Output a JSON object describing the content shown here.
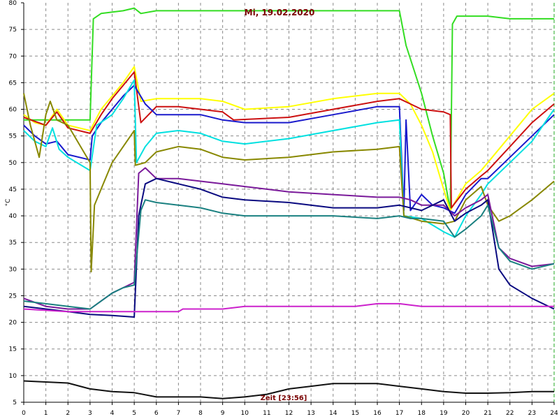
{
  "chart_data": {
    "type": "line",
    "title": "Mi, 19.02.2020",
    "xlabel": "Zeit [23:56]",
    "ylabel": "°C",
    "xlim": [
      0,
      24
    ],
    "ylim": [
      5,
      80
    ],
    "x_ticks": [
      0,
      1,
      2,
      3,
      4,
      5,
      6,
      7,
      8,
      9,
      10,
      11,
      12,
      13,
      14,
      15,
      16,
      17,
      18,
      19,
      20,
      21,
      22,
      23,
      24
    ],
    "y_ticks": [
      5,
      10,
      15,
      20,
      25,
      30,
      35,
      40,
      45,
      50,
      55,
      60,
      65,
      70,
      75,
      80
    ],
    "grid": true,
    "series": [
      {
        "color": "#33dd22",
        "points": [
          [
            0,
            58
          ],
          [
            1.5,
            58
          ],
          [
            3,
            58
          ],
          [
            3.15,
            77
          ],
          [
            3.5,
            78
          ],
          [
            4.5,
            78.5
          ],
          [
            5,
            79
          ],
          [
            5.3,
            78
          ],
          [
            6,
            78.5
          ],
          [
            10,
            78.5
          ],
          [
            14,
            78.5
          ],
          [
            17,
            78.5
          ],
          [
            17.3,
            72
          ],
          [
            18,
            63
          ],
          [
            18.5,
            55
          ],
          [
            19,
            48
          ],
          [
            19.3,
            41
          ],
          [
            19.4,
            76
          ],
          [
            19.6,
            77.5
          ],
          [
            21,
            77.5
          ],
          [
            22,
            77
          ],
          [
            24,
            77
          ]
        ]
      },
      {
        "color": "#ffff00",
        "points": [
          [
            0,
            59
          ],
          [
            0.5,
            57.5
          ],
          [
            1,
            57
          ],
          [
            1.5,
            60
          ],
          [
            2,
            57
          ],
          [
            3,
            56
          ],
          [
            3.5,
            60
          ],
          [
            4,
            62.5
          ],
          [
            4.5,
            65
          ],
          [
            5,
            68
          ],
          [
            5.3,
            61.5
          ],
          [
            6,
            62
          ],
          [
            7,
            62
          ],
          [
            8,
            62
          ],
          [
            9,
            61.5
          ],
          [
            10,
            60
          ],
          [
            12,
            60.5
          ],
          [
            14,
            62
          ],
          [
            16,
            63
          ],
          [
            17,
            63
          ],
          [
            17.5,
            61
          ],
          [
            18,
            57
          ],
          [
            18.5,
            52
          ],
          [
            19,
            45
          ],
          [
            19.3,
            41
          ],
          [
            20,
            46
          ],
          [
            20.7,
            48.5
          ],
          [
            21,
            50
          ],
          [
            22,
            55
          ],
          [
            23,
            60
          ],
          [
            24,
            63
          ]
        ]
      },
      {
        "color": "#cc1111",
        "points": [
          [
            0,
            58.5
          ],
          [
            1,
            57
          ],
          [
            1.5,
            59.5
          ],
          [
            2,
            56.5
          ],
          [
            3,
            55.5
          ],
          [
            3.5,
            59
          ],
          [
            4,
            62
          ],
          [
            4.5,
            64.5
          ],
          [
            5,
            67
          ],
          [
            5.3,
            57.5
          ],
          [
            6,
            60.5
          ],
          [
            7,
            60.5
          ],
          [
            8,
            60
          ],
          [
            9,
            59.5
          ],
          [
            9.5,
            58
          ],
          [
            12,
            58.5
          ],
          [
            14,
            60
          ],
          [
            16,
            61.5
          ],
          [
            17,
            62
          ],
          [
            17.5,
            61
          ],
          [
            18,
            60
          ],
          [
            19,
            59.5
          ],
          [
            19.3,
            59
          ],
          [
            19.35,
            41.5
          ],
          [
            20,
            45
          ],
          [
            20.7,
            47.5
          ],
          [
            21,
            48.5
          ],
          [
            22,
            53
          ],
          [
            23,
            57.5
          ],
          [
            24,
            61
          ]
        ]
      },
      {
        "color": "#1a1acc",
        "points": [
          [
            0,
            57
          ],
          [
            0.5,
            55
          ],
          [
            1,
            53.5
          ],
          [
            1.5,
            54
          ],
          [
            2,
            51.5
          ],
          [
            3,
            50.5
          ],
          [
            3.1,
            55
          ],
          [
            3.5,
            57.5
          ],
          [
            4,
            60
          ],
          [
            4.5,
            62.5
          ],
          [
            5,
            64.5
          ],
          [
            5.5,
            61
          ],
          [
            6,
            59
          ],
          [
            7,
            59
          ],
          [
            8,
            59
          ],
          [
            9,
            58
          ],
          [
            10,
            57.5
          ],
          [
            12,
            57.5
          ],
          [
            14,
            59
          ],
          [
            16,
            60.5
          ],
          [
            17,
            60.5
          ],
          [
            17.2,
            41
          ],
          [
            17.3,
            58
          ],
          [
            17.5,
            41
          ],
          [
            18,
            44
          ],
          [
            18.5,
            42
          ],
          [
            19,
            41.5
          ],
          [
            19.5,
            40.5
          ],
          [
            20,
            44
          ],
          [
            20.7,
            47
          ],
          [
            21,
            47
          ],
          [
            22,
            51
          ],
          [
            23,
            55
          ],
          [
            24,
            59
          ]
        ]
      },
      {
        "color": "#00e0e0",
        "points": [
          [
            0,
            56
          ],
          [
            0.5,
            54
          ],
          [
            1,
            53
          ],
          [
            1.3,
            56.5
          ],
          [
            1.6,
            52.5
          ],
          [
            2,
            51
          ],
          [
            3,
            48.5
          ],
          [
            3.3,
            57
          ],
          [
            4,
            59
          ],
          [
            4.5,
            62
          ],
          [
            5,
            65.5
          ],
          [
            5.1,
            50
          ],
          [
            5.5,
            53
          ],
          [
            6,
            55.5
          ],
          [
            7,
            56
          ],
          [
            8,
            55.5
          ],
          [
            9,
            54
          ],
          [
            10,
            53.5
          ],
          [
            12,
            54.5
          ],
          [
            14,
            56
          ],
          [
            16,
            57.5
          ],
          [
            17,
            58
          ],
          [
            17.2,
            40
          ],
          [
            18,
            39.5
          ],
          [
            19,
            37
          ],
          [
            19.5,
            36
          ],
          [
            20,
            40
          ],
          [
            20.7,
            44
          ],
          [
            21,
            46
          ],
          [
            22,
            50
          ],
          [
            23,
            54
          ],
          [
            24,
            60
          ]
        ]
      },
      {
        "color": "#888800",
        "points": [
          [
            0,
            63
          ],
          [
            0.3,
            57
          ],
          [
            0.7,
            51
          ],
          [
            1,
            59
          ],
          [
            1.2,
            61.5
          ],
          [
            1.5,
            58
          ],
          [
            2,
            57
          ],
          [
            3,
            50
          ],
          [
            3.05,
            29.5
          ],
          [
            3.2,
            42
          ],
          [
            3.6,
            46
          ],
          [
            4,
            50
          ],
          [
            4.5,
            53
          ],
          [
            5,
            56
          ],
          [
            5.05,
            49.5
          ],
          [
            5.5,
            50
          ],
          [
            6,
            52
          ],
          [
            7,
            53
          ],
          [
            8,
            52.5
          ],
          [
            9,
            51
          ],
          [
            10,
            50.5
          ],
          [
            12,
            51
          ],
          [
            14,
            52
          ],
          [
            16,
            52.5
          ],
          [
            17,
            53
          ],
          [
            17.2,
            40
          ],
          [
            18,
            39
          ],
          [
            19,
            38.5
          ],
          [
            19.5,
            39
          ],
          [
            20,
            43
          ],
          [
            20.7,
            45.5
          ],
          [
            21,
            42
          ],
          [
            21.5,
            39
          ],
          [
            22,
            40
          ],
          [
            23,
            43
          ],
          [
            24,
            46.5
          ]
        ]
      },
      {
        "color": "#7a1a9a",
        "points": [
          [
            0,
            24.5
          ],
          [
            1,
            23
          ],
          [
            2,
            22.5
          ],
          [
            3,
            22.5
          ],
          [
            3.5,
            24
          ],
          [
            4,
            25.5
          ],
          [
            4.5,
            26.5
          ],
          [
            5,
            27.5
          ],
          [
            5.2,
            48
          ],
          [
            5.5,
            49
          ],
          [
            6,
            47
          ],
          [
            7,
            47
          ],
          [
            8,
            46.5
          ],
          [
            9,
            46
          ],
          [
            10,
            45.5
          ],
          [
            11,
            45
          ],
          [
            12,
            44.5
          ],
          [
            14,
            44
          ],
          [
            16,
            43.5
          ],
          [
            17,
            43.5
          ],
          [
            17.5,
            43
          ],
          [
            18,
            42
          ],
          [
            19,
            42
          ],
          [
            19.5,
            40
          ],
          [
            20,
            41.5
          ],
          [
            20.7,
            43
          ],
          [
            21,
            44
          ],
          [
            21.5,
            34
          ],
          [
            22,
            32
          ],
          [
            23,
            30.5
          ],
          [
            24,
            31
          ]
        ]
      },
      {
        "color": "#0a0a80",
        "points": [
          [
            0,
            23
          ],
          [
            1,
            22.5
          ],
          [
            2,
            22
          ],
          [
            3,
            21.5
          ],
          [
            4,
            21.3
          ],
          [
            5,
            21
          ],
          [
            5.2,
            40
          ],
          [
            5.5,
            46
          ],
          [
            6,
            47
          ],
          [
            7,
            46
          ],
          [
            8,
            45
          ],
          [
            9,
            43.5
          ],
          [
            10,
            43
          ],
          [
            12,
            42.5
          ],
          [
            14,
            41.5
          ],
          [
            16,
            41.5
          ],
          [
            17,
            42
          ],
          [
            18,
            41
          ],
          [
            19,
            43
          ],
          [
            19.5,
            39
          ],
          [
            20,
            40.5
          ],
          [
            20.7,
            42
          ],
          [
            21,
            43
          ],
          [
            21.5,
            30
          ],
          [
            22,
            27
          ],
          [
            23,
            24.5
          ],
          [
            24,
            22.5
          ]
        ]
      },
      {
        "color": "#1a8080",
        "points": [
          [
            0,
            24
          ],
          [
            1,
            23.5
          ],
          [
            2,
            23
          ],
          [
            3,
            22.5
          ],
          [
            3.5,
            24
          ],
          [
            4,
            25.5
          ],
          [
            4.5,
            26.5
          ],
          [
            5,
            27
          ],
          [
            5.3,
            41
          ],
          [
            5.5,
            43
          ],
          [
            6,
            42.5
          ],
          [
            7,
            42
          ],
          [
            8,
            41.5
          ],
          [
            9,
            40.5
          ],
          [
            10,
            40
          ],
          [
            12,
            40
          ],
          [
            14,
            40
          ],
          [
            16,
            39.5
          ],
          [
            17,
            40
          ],
          [
            17.5,
            39.5
          ],
          [
            18,
            39.5
          ],
          [
            19,
            39
          ],
          [
            19.5,
            36
          ],
          [
            20,
            37.5
          ],
          [
            20.7,
            40
          ],
          [
            21,
            42
          ],
          [
            21.5,
            34
          ],
          [
            22,
            31.5
          ],
          [
            23,
            30
          ],
          [
            24,
            31
          ]
        ]
      },
      {
        "color": "#cc22cc",
        "points": [
          [
            0,
            22.5
          ],
          [
            2,
            22
          ],
          [
            4,
            22
          ],
          [
            6,
            22
          ],
          [
            7,
            22
          ],
          [
            7.2,
            22.5
          ],
          [
            8,
            22.5
          ],
          [
            9,
            22.5
          ],
          [
            10,
            23
          ],
          [
            12,
            23
          ],
          [
            15,
            23
          ],
          [
            16,
            23.5
          ],
          [
            17,
            23.5
          ],
          [
            18,
            23
          ],
          [
            20,
            23
          ],
          [
            24,
            23
          ]
        ]
      },
      {
        "color": "#111111",
        "points": [
          [
            0,
            9
          ],
          [
            1,
            8.8
          ],
          [
            2,
            8.6
          ],
          [
            3,
            7.5
          ],
          [
            4,
            7
          ],
          [
            5,
            6.8
          ],
          [
            6,
            6
          ],
          [
            7,
            6
          ],
          [
            8,
            6
          ],
          [
            9,
            5.7
          ],
          [
            10,
            6
          ],
          [
            11,
            6.5
          ],
          [
            12,
            7.5
          ],
          [
            13,
            8
          ],
          [
            14,
            8.5
          ],
          [
            15,
            8.5
          ],
          [
            16,
            8.5
          ],
          [
            17,
            8
          ],
          [
            18,
            7.5
          ],
          [
            19,
            7
          ],
          [
            20,
            6.7
          ],
          [
            21,
            6.7
          ],
          [
            22,
            6.8
          ],
          [
            23,
            7
          ],
          [
            24,
            7
          ]
        ]
      }
    ]
  }
}
